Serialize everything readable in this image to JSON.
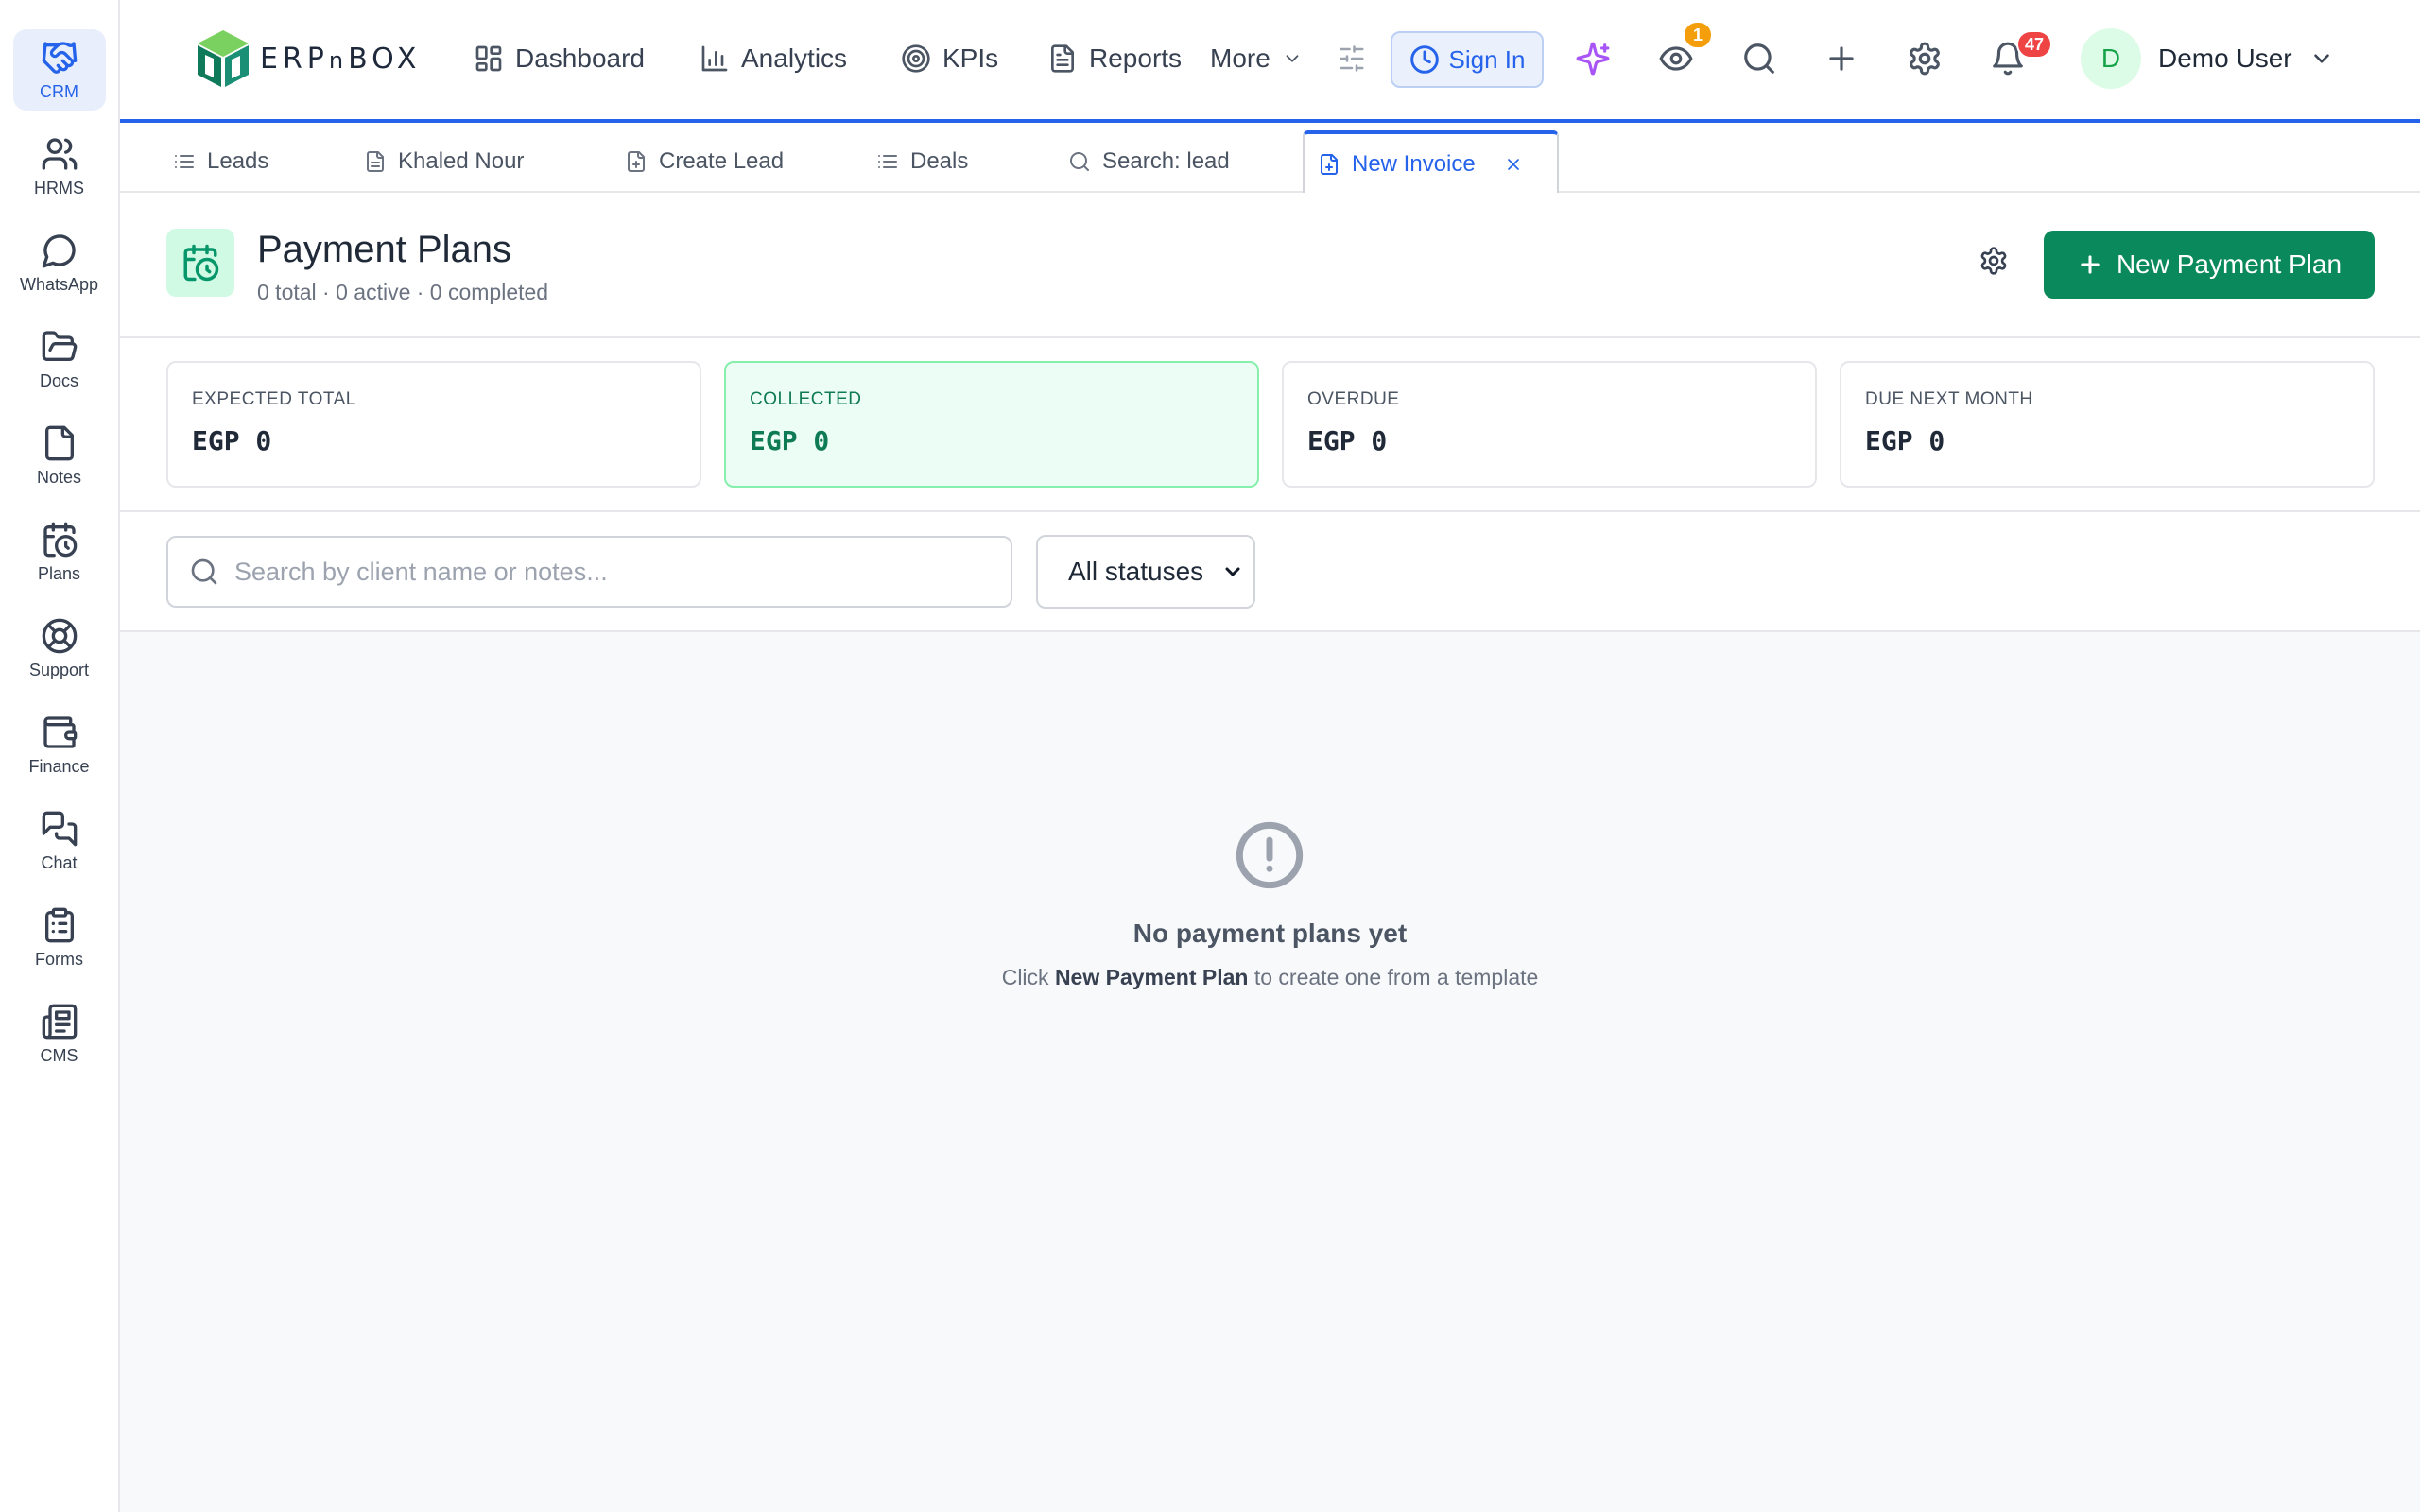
{
  "sidebar": {
    "items": [
      {
        "label": "CRM",
        "icon": "handshake-icon"
      },
      {
        "label": "HRMS",
        "icon": "users-icon"
      },
      {
        "label": "WhatsApp",
        "icon": "message-circle-icon"
      },
      {
        "label": "Docs",
        "icon": "folder-open-icon"
      },
      {
        "label": "Notes",
        "icon": "file-icon"
      },
      {
        "label": "Plans",
        "icon": "calendar-clock-icon"
      },
      {
        "label": "Support",
        "icon": "life-buoy-icon"
      },
      {
        "label": "Finance",
        "icon": "wallet-icon"
      },
      {
        "label": "Chat",
        "icon": "messages-icon"
      },
      {
        "label": "Forms",
        "icon": "clipboard-list-icon"
      },
      {
        "label": "CMS",
        "icon": "newspaper-icon"
      }
    ],
    "active": "CRM"
  },
  "topbar": {
    "logo_text_1": "ERP",
    "logo_text_2": "n",
    "logo_text_3": "BOX",
    "nav": [
      {
        "label": "Dashboard",
        "icon": "layout-grid-icon"
      },
      {
        "label": "Analytics",
        "icon": "bar-chart-icon"
      },
      {
        "label": "KPIs",
        "icon": "target-icon"
      },
      {
        "label": "Reports",
        "icon": "file-text-icon"
      },
      {
        "label": "More",
        "icon": "chevron-down-icon"
      }
    ],
    "sign_in_label": "Sign In",
    "watch_badge": "1",
    "notifications_badge": "47",
    "user": {
      "initial": "D",
      "name": "Demo User"
    }
  },
  "tabs": [
    {
      "label": "Leads",
      "icon": "list-icon"
    },
    {
      "label": "Khaled Nour",
      "icon": "file-text-icon"
    },
    {
      "label": "Create Lead",
      "icon": "file-plus-icon"
    },
    {
      "label": "Deals",
      "icon": "list-icon"
    },
    {
      "label": "Search: lead",
      "icon": "search-icon"
    },
    {
      "label": "New Invoice",
      "icon": "file-plus-icon",
      "active": true
    }
  ],
  "page": {
    "title": "Payment Plans",
    "subtitle": "0 total · 0 active · 0 completed",
    "new_button_label": "New Payment Plan"
  },
  "stats": [
    {
      "label": "EXPECTED TOTAL",
      "value": "EGP 0"
    },
    {
      "label": "COLLECTED",
      "value": "EGP 0"
    },
    {
      "label": "OVERDUE",
      "value": "EGP 0"
    },
    {
      "label": "DUE NEXT MONTH",
      "value": "EGP 0"
    }
  ],
  "filters": {
    "search_placeholder": "Search by client name or notes...",
    "search_value": "",
    "status_selected": "All statuses"
  },
  "empty_state": {
    "title": "No payment plans yet",
    "hint_prefix": "Click ",
    "hint_strong": "New Payment Plan",
    "hint_suffix": " to create one from a template"
  },
  "colors": {
    "primary": "#2563eb",
    "success": "#0a8a5c",
    "notification_badge": "#ef4444",
    "watch_badge": "#f59e0b",
    "ai_icon": "#a855f7"
  }
}
